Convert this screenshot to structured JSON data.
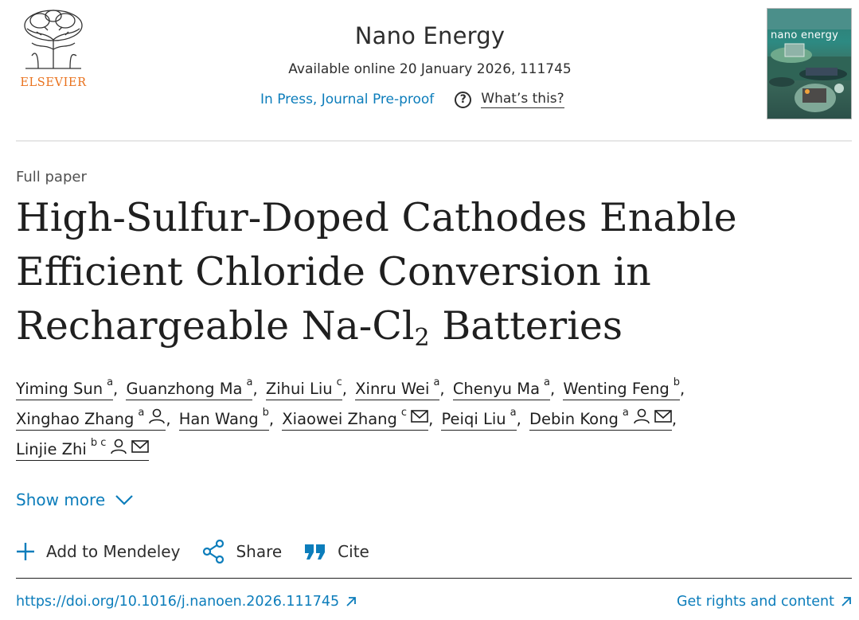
{
  "header": {
    "publisher_logo_text": "ELSEVIER",
    "journal_name": "Nano Energy",
    "availability": "Available online 20 January 2026, 111745",
    "status_link": "In Press, Journal Pre-proof",
    "help_link": "What’s this?",
    "cover_title": "nano energy"
  },
  "article": {
    "type": "Full paper",
    "title_part1": "High-Sulfur-Doped Cathodes Enable Efficient Chloride Conversion in Rechargeable Na-Cl",
    "title_sub": "2",
    "title_part2": " Batteries",
    "authors": [
      {
        "name": "Yiming Sun",
        "aff": "a"
      },
      {
        "name": "Guanzhong Ma",
        "aff": "a"
      },
      {
        "name": "Zihui Liu",
        "aff": "c"
      },
      {
        "name": "Xinru Wei",
        "aff": "a"
      },
      {
        "name": "Chenyu Ma",
        "aff": "a"
      },
      {
        "name": "Wenting Feng",
        "aff": "b"
      },
      {
        "name": "Xinghao Zhang",
        "aff": "a"
      },
      {
        "name": "Han Wang",
        "aff": "b"
      },
      {
        "name": "Xiaowei Zhang",
        "aff": "c"
      },
      {
        "name": "Peiqi Liu",
        "aff": "a"
      },
      {
        "name": "Debin Kong",
        "aff": "a"
      },
      {
        "name": "Linjie Zhi",
        "aff": "b c"
      }
    ],
    "show_more": "Show more"
  },
  "actions": {
    "mendeley": "Add to Mendeley",
    "share": "Share",
    "cite": "Cite"
  },
  "footer": {
    "doi": "https://doi.org/10.1016/j.nanoen.2026.111745",
    "rights": "Get rights and content"
  },
  "colors": {
    "link": "#0c7dbb",
    "brand": "#e9711c",
    "text": "#1f1f1f"
  }
}
